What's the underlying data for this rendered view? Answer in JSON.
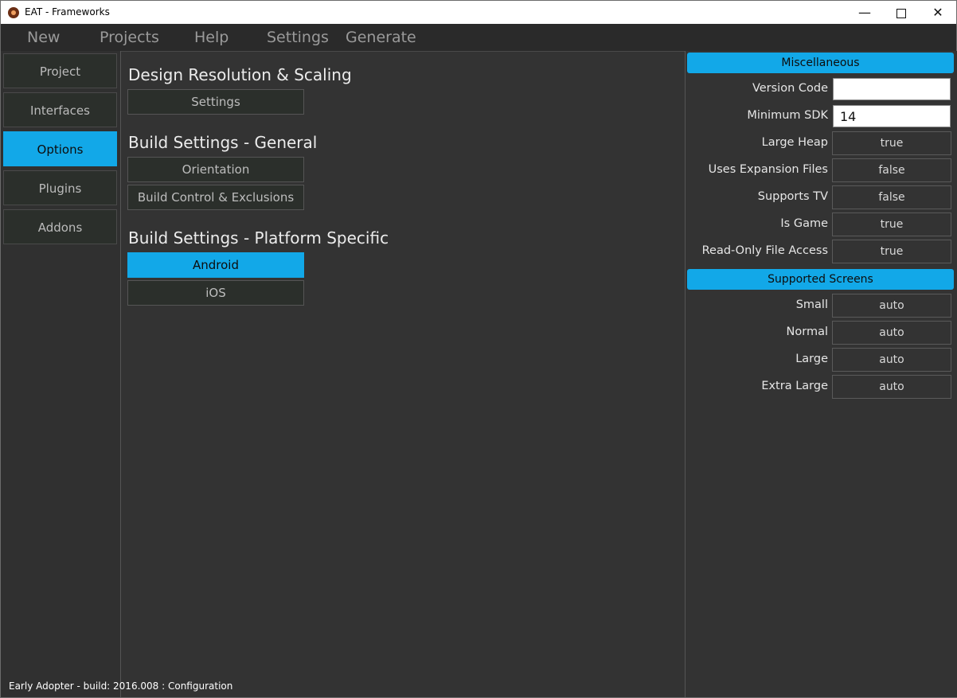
{
  "window": {
    "title": "EAT - Frameworks",
    "min_glyph": "—",
    "close_glyph": "✕"
  },
  "menu": [
    "New",
    "Projects",
    "Help",
    "Settings",
    "Generate"
  ],
  "nav": [
    {
      "label": "Project",
      "active": false
    },
    {
      "label": "Interfaces",
      "active": false
    },
    {
      "label": "Options",
      "active": true
    },
    {
      "label": "Plugins",
      "active": false
    },
    {
      "label": "Addons",
      "active": false
    }
  ],
  "center": {
    "section1": {
      "title": "Design Resolution & Scaling",
      "buttons": [
        "Settings"
      ]
    },
    "section2": {
      "title": "Build Settings - General",
      "buttons": [
        "Orientation",
        "Build Control & Exclusions"
      ]
    },
    "section3": {
      "title": "Build Settings - Platform Specific",
      "buttons": [
        "Android",
        "iOS"
      ],
      "active": "Android"
    }
  },
  "right": {
    "misc_header": "Miscellaneous",
    "version_code": {
      "label": "Version Code",
      "value": ""
    },
    "min_sdk": {
      "label": "Minimum SDK",
      "value": "14"
    },
    "misc_rows": [
      {
        "label": "Large Heap",
        "value": "true"
      },
      {
        "label": "Uses Expansion Files",
        "value": "false"
      },
      {
        "label": "Supports TV",
        "value": "false"
      },
      {
        "label": "Is Game",
        "value": "true"
      },
      {
        "label": "Read-Only File Access",
        "value": "true"
      }
    ],
    "screens_header": "Supported Screens",
    "screen_rows": [
      {
        "label": "Small",
        "value": "auto"
      },
      {
        "label": "Normal",
        "value": "auto"
      },
      {
        "label": "Large",
        "value": "auto"
      },
      {
        "label": "Extra Large",
        "value": "auto"
      }
    ]
  },
  "status": "Early Adopter - build: 2016.008 : Configuration",
  "colors": {
    "accent": "#12a8e8",
    "background": "#333333",
    "button": "#2b2f2b"
  }
}
